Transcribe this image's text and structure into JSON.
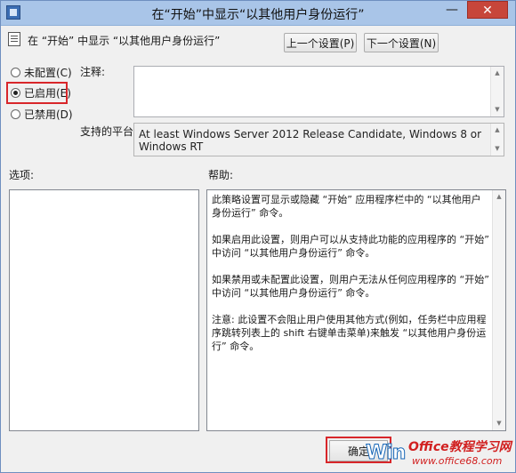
{
  "window": {
    "title": "在“开始”中显示“以其他用户身份运行”",
    "minimize": "—",
    "close": "✕"
  },
  "header": {
    "title": "在 “开始” 中显示 “以其他用户身份运行”"
  },
  "nav": {
    "prev": "上一个设置(P)",
    "next": "下一个设置(N)"
  },
  "state": {
    "options": [
      {
        "label": "未配置(C)",
        "checked": false
      },
      {
        "label": "已启用(E)",
        "checked": true
      },
      {
        "label": "已禁用(D)",
        "checked": false
      }
    ]
  },
  "comment": {
    "label": "注释:",
    "value": ""
  },
  "supported": {
    "label": "支持的平台:",
    "value": "At least Windows Server 2012 Release Candidate, Windows 8 or Windows RT"
  },
  "options_panel": {
    "label": "选项:"
  },
  "help_panel": {
    "label": "帮助:",
    "paragraphs": [
      "此策略设置可显示或隐藏 “开始” 应用程序栏中的 “以其他用户身份运行” 命令。",
      "如果启用此设置，则用户可以从支持此功能的应用程序的 “开始” 中访问 “以其他用户身份运行” 命令。",
      "如果禁用或未配置此设置，则用户无法从任何应用程序的 “开始” 中访问 “以其他用户身份运行” 命令。",
      "注意: 此设置不会阻止用户使用其他方式(例如，任务栏中应用程序跳转列表上的 shift 右键单击菜单)来触发 “以其他用户身份运行” 命令。"
    ]
  },
  "footer": {
    "ok": "确定"
  },
  "watermark": {
    "logo": "Win",
    "brand": "Office教程学习网",
    "url": "www.office68.com"
  },
  "icons": {
    "scroll_up": "▲",
    "scroll_down": "▼"
  }
}
